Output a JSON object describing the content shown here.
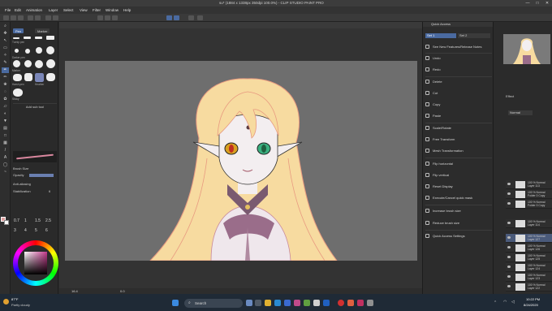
{
  "window": {
    "title": "su* (1884 x 1338px 350dpi 100.0%) - CLIP STUDIO PAINT PRO",
    "controls": [
      "—",
      "□",
      "✕"
    ]
  },
  "menu": [
    "File",
    "Edit",
    "Animation",
    "Layer",
    "Select",
    "View",
    "Filter",
    "Window",
    "Help"
  ],
  "subtool": {
    "tabs": [
      "Pen",
      "Marker"
    ],
    "brushes": [
      "Turnip pen",
      "G-pen",
      "Mapping pen",
      "Real G-pen",
      "Darker pen",
      "Pen",
      "Marker",
      "Felt pen",
      "Textured",
      "Harsh pen",
      "Bold",
      "Soft",
      "Rough",
      "Heather",
      "Sticky",
      "Round"
    ],
    "add_label": "Add sub tool",
    "props": [
      {
        "label": "Brush Size",
        "value": "5.0"
      },
      {
        "label": "Opacity",
        "value": "100"
      },
      {
        "label": "Anti-aliasing",
        "value": ""
      },
      {
        "label": "Stabilization",
        "value": "6"
      }
    ],
    "size_presets": [
      "0.7",
      "1",
      "1.5",
      "2",
      "2.5",
      "3",
      "4",
      "5",
      "6",
      "7",
      "8",
      "10"
    ]
  },
  "quick_access": {
    "header": "Quick Access",
    "sets": [
      "Set 1",
      "Set 2"
    ],
    "items": [
      "See New Features/Release Notes",
      "Undo",
      "Redo",
      "Delete",
      "Cut",
      "Copy",
      "Paste",
      "Scale/Rotate",
      "Free Transform",
      "Mesh Transformation",
      "Flip horizontal",
      "Flip vertical",
      "Reset Display",
      "Execute/Cancel quick mask",
      "Increase brush size",
      "Reduce brush size",
      "Quick Access Settings"
    ]
  },
  "layers": {
    "panel_label": "Effect",
    "blend": "Normal",
    "opacity": "100",
    "items": [
      {
        "pct": "100 % Normal",
        "name": "Layer 113"
      },
      {
        "pct": "100 % Normal",
        "name": "Folder 3 Copy"
      },
      {
        "pct": "100 % Normal",
        "name": "Folder 3 Copy"
      },
      {
        "pct": "100 % Normal",
        "name": "Layer 114"
      },
      {
        "pct": "100 % Normal",
        "name": "Layer 127",
        "selected": true
      },
      {
        "pct": "100 % Normal",
        "name": "Layer 126"
      },
      {
        "pct": "100 % Normal",
        "name": "Layer 125"
      },
      {
        "pct": "100 % Normal",
        "name": "Layer 124"
      },
      {
        "pct": "100 % Normal",
        "name": "Layer 123"
      },
      {
        "pct": "100 % Normal",
        "name": "Layer 122"
      }
    ]
  },
  "status": {
    "zoom": "16.4",
    "coords": "0.0"
  },
  "taskbar": {
    "weather_temp": "87°F",
    "weather_desc": "Partly cloudy",
    "search_placeholder": "Search",
    "time": "10:22 PM",
    "date": "8/24/2020"
  },
  "colors": {
    "canvas_bg": "#6e6e6e",
    "app_bg": "#2b2b2b",
    "accent": "#4a5a7a",
    "hair": "#f7dba0",
    "skin": "#f3eef0"
  }
}
